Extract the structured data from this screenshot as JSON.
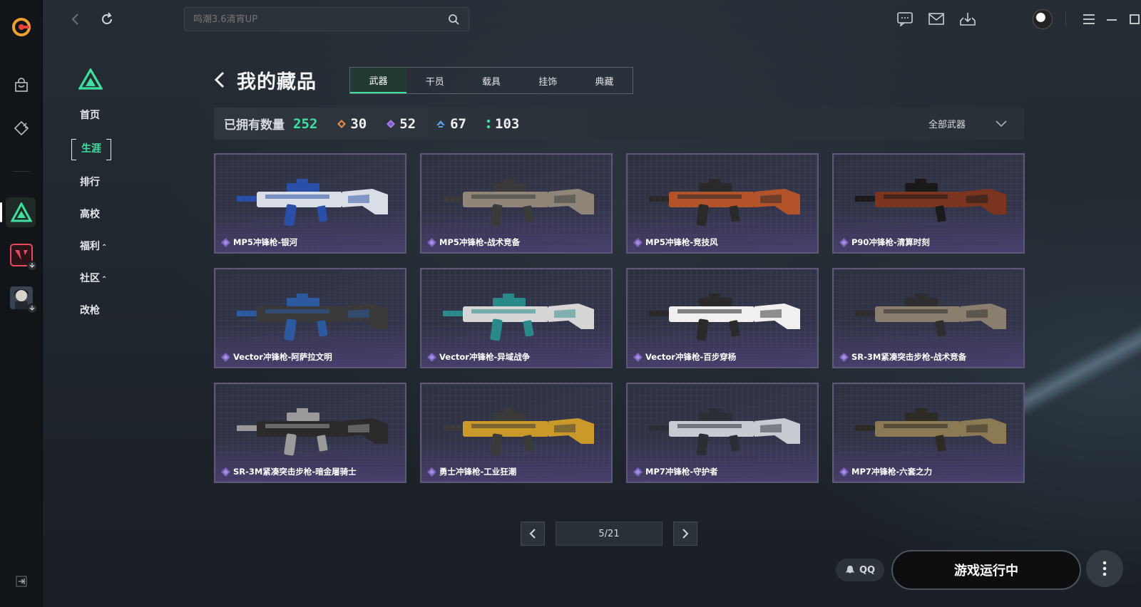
{
  "search": {
    "placeholder": "鸣潮3.6清宵UP"
  },
  "subnav": {
    "items": [
      {
        "label": "首页"
      },
      {
        "label": "生涯"
      },
      {
        "label": "排行"
      },
      {
        "label": "高校"
      },
      {
        "label": "福利",
        "caret": "⌃"
      },
      {
        "label": "社区",
        "caret": "⌃"
      },
      {
        "label": "改枪"
      }
    ]
  },
  "page": {
    "title": "我的藏品"
  },
  "tabs": [
    {
      "label": "武器"
    },
    {
      "label": "干员"
    },
    {
      "label": "载具"
    },
    {
      "label": "挂饰"
    },
    {
      "label": "典藏"
    }
  ],
  "stats": {
    "label": "已拥有数量",
    "total": "252",
    "counts": [
      {
        "icon": "orange-diamond-icon",
        "color": "#e08a4b",
        "value": "30"
      },
      {
        "icon": "purple-diamond-icon",
        "color": "#a37de6",
        "value": "52"
      },
      {
        "icon": "blue-chevron-icon",
        "color": "#5aa3e8",
        "value": "67"
      },
      {
        "icon": "green-dots-icon",
        "color": "#3ee0a2",
        "value": "103"
      }
    ],
    "filter": "全部武器"
  },
  "cards": [
    {
      "name": "MP5冲锋枪-银河",
      "palette": [
        "#d8dde6",
        "#2a4fa8"
      ]
    },
    {
      "name": "MP5冲锋枪-战术竞备",
      "palette": [
        "#8f8578",
        "#3a3a3a"
      ]
    },
    {
      "name": "MP5冲锋枪-竞技风",
      "palette": [
        "#b3532a",
        "#2a2a2a"
      ]
    },
    {
      "name": "P90冲锋枪-清算时刻",
      "palette": [
        "#7a3420",
        "#1a1a1a"
      ]
    },
    {
      "name": "Vector冲锋枪-阿萨拉文明",
      "palette": [
        "#3a3a3a",
        "#2c5aa0"
      ]
    },
    {
      "name": "Vector冲锋枪-异域战争",
      "palette": [
        "#d6d6d6",
        "#2a8a8a"
      ]
    },
    {
      "name": "Vector冲锋枪-百步穿杨",
      "palette": [
        "#f0f0f0",
        "#2a2a2a"
      ]
    },
    {
      "name": "SR-3M紧凑突击步枪-战术竞备",
      "palette": [
        "#8a7f6e",
        "#2e2e2e"
      ]
    },
    {
      "name": "SR-3M紧凑突击步枪-暗金屠骑士",
      "palette": [
        "#2a2a2a",
        "#9a9a9a"
      ]
    },
    {
      "name": "勇士冲锋枪-工业狂潮",
      "palette": [
        "#c99a2a",
        "#3a3a3a"
      ]
    },
    {
      "name": "MP7冲锋枪-守护者",
      "palette": [
        "#c7ccd2",
        "#2a2f36"
      ]
    },
    {
      "name": "MP7冲锋枪-六套之力",
      "palette": [
        "#8c7a55",
        "#2e2b24"
      ]
    }
  ],
  "pager": {
    "info": "5/21"
  },
  "bottom": {
    "qq": "QQ",
    "play": "游戏运行中"
  },
  "colors": {
    "accent": "#3ee0a2",
    "card_border": "#5d5878"
  }
}
